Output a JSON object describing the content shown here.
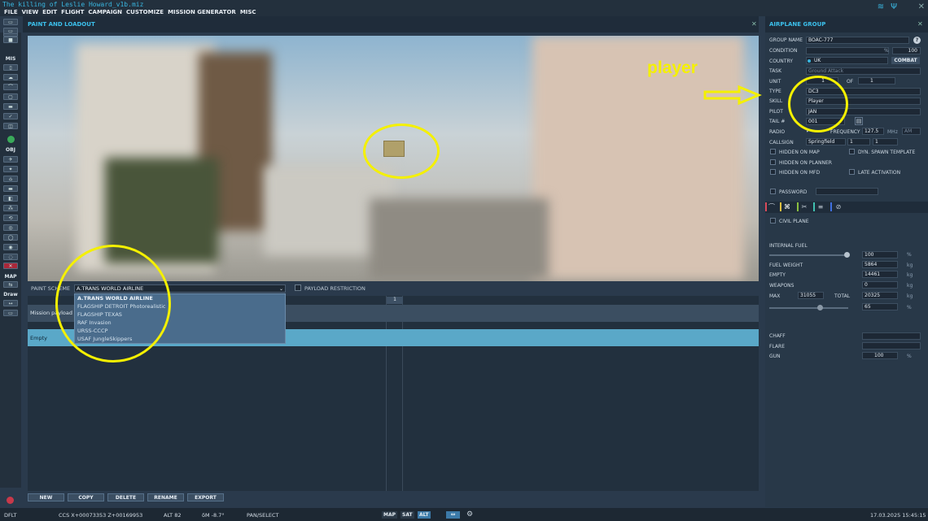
{
  "window": {
    "title": "The killing of Leslie Howard_v1b.miz"
  },
  "menu": [
    "FILE",
    "VIEW",
    "EDIT",
    "FLIGHT",
    "CAMPAIGN",
    "CUSTOMIZE",
    "MISSION GENERATOR",
    "MISC"
  ],
  "toolbar": {
    "mis": "MIS",
    "obj": "OBJ",
    "map": "MAP",
    "draw": "Draw"
  },
  "paint_loadout": {
    "title": "PAINT AND LOADOUT",
    "paint_scheme_label": "PAINT SCHEME",
    "paint_scheme_value": "A.TRANS WORLD AIRLINE",
    "payload_restriction": "PAYLOAD RESTRICTION",
    "schemes": [
      "A.TRANS WORLD AIRLINE",
      "FLAGSHIP DETROIT Photorealistic",
      "FLAGSHIP TEXAS",
      "RAF Invasion",
      "URSS-CCCP",
      "USAF JungleSkippers"
    ],
    "pylon": "1",
    "rows": {
      "mission": "Mission payload",
      "empty": "Empty"
    },
    "buttons": {
      "new": "NEW",
      "copy": "COPY",
      "delete": "DELETE",
      "rename": "RENAME",
      "export": "EXPORT"
    }
  },
  "group": {
    "title": "AIRPLANE GROUP",
    "help": "?",
    "labels": {
      "group_name": "GROUP NAME",
      "condition": "CONDITION",
      "country": "COUNTRY",
      "task": "TASK",
      "unit": "UNIT",
      "type": "TYPE",
      "skill": "SKILL",
      "pilot": "PILOT",
      "tail": "TAIL #",
      "radio": "RADIO",
      "frequency": "FREQUENCY",
      "callsign": "CALLSIGN",
      "of": "OF"
    },
    "values": {
      "group_name": "BOAC-777",
      "condition": "",
      "condition_pct": "100",
      "country": "UK",
      "combat": "COMBAT",
      "task": "Ground Attack",
      "unit": "1",
      "unit_of": "1",
      "type": "DC3",
      "skill": "Player",
      "pilot": "JAN",
      "tail": "001",
      "frequency": "127.5",
      "freq_unit": "MHz",
      "modulation": "AM",
      "callsign": "Springfield",
      "callsign_n1": "1",
      "callsign_n2": "1"
    },
    "checks": {
      "hidden_map": "HIDDEN ON MAP",
      "dyn_spawn": "DYN. SPAWN TEMPLATE",
      "hidden_planner": "HIDDEN ON PLANNER",
      "hidden_mfd": "HIDDEN ON MFD",
      "late_activation": "LATE ACTIVATION",
      "password": "PASSWORD",
      "civil_plane": "CIVIL PLANE"
    },
    "fuel": {
      "internal_fuel": "INTERNAL FUEL",
      "fuel_pct": "100",
      "pct": "%",
      "fuel_weight_label": "FUEL WEIGHT",
      "fuel_weight": "5864",
      "empty_label": "EMPTY",
      "empty": "14461",
      "weapons_label": "WEAPONS",
      "weapons": "0",
      "max_label": "MAX",
      "max": "31055",
      "total_label": "TOTAL",
      "total": "20325",
      "load_pct": "65",
      "kg": "kg"
    },
    "counter": {
      "chaff": "CHAFF",
      "flare": "FLARE",
      "gun": "GUN",
      "gun_pct": "100"
    }
  },
  "status": {
    "coords": "CCS  X+00073353 Z+00169953",
    "alt": "ALT  82",
    "dm": "δM  -8.7°",
    "mode": "PAN/SELECT",
    "map_btn": "MAP",
    "sat_btn": "SAT",
    "alt_btn": "ALT",
    "datetime": "17.03.2025 15:45:15",
    "layer": "DFLT"
  },
  "annotation": {
    "player": "player"
  }
}
